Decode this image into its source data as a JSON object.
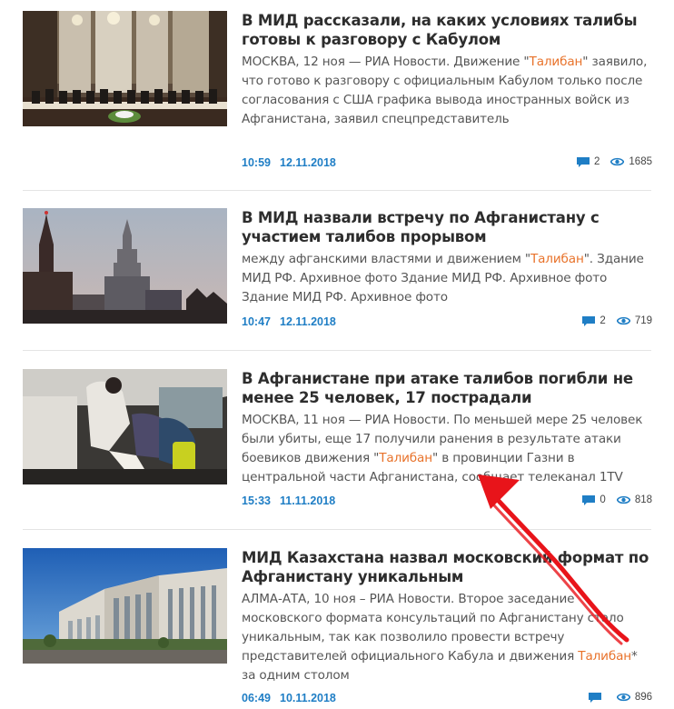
{
  "highlight_color": "#e8722a",
  "link_color": "#1f7ec5",
  "annotation_color": "#e8141a",
  "items": [
    {
      "title": "В МИД рассказали, на каких условиях талибы готовы к разговору с Кабулом",
      "lead_before": "МОСКВА, 12 ноя — РИА Новости. Движение \"",
      "lead_highlight": "Талибан",
      "lead_after": "\" заявило, что готово к разговору с официальным Кабулом только после согласования с США графика вывода иностранных войск из Афганистана, заявил спецпредставитель",
      "time": "10:59",
      "date": "12.11.2018",
      "comments": "2",
      "views": "1685",
      "thumb_icon": "conference-photo"
    },
    {
      "title": "В МИД назвали встречу по Афганистану с участием талибов прорывом",
      "lead_before": "между афганскими властями и движением \"",
      "lead_highlight": "Талибан",
      "lead_after": "\". Здание МИД РФ. Архивное фото Здание МИД РФ. Архивное фото Здание МИД РФ. Архивное фото",
      "time": "10:47",
      "date": "12.11.2018",
      "comments": "2",
      "views": "719",
      "thumb_icon": "moscow-skyline-photo"
    },
    {
      "title": "В Афганистане при атаке талибов погибли не менее 25 человек, 17 пострадали",
      "lead_before": "МОСКВА, 11 ноя — РИА Новости. По меньшей мере 25 человек были убиты, еще 17 получили ранения в результате атаки боевиков движения \"",
      "lead_highlight": "Талибан",
      "lead_after": "\" в провинции Газни в центральной части Афганистана, сообщает телеканал 1TV",
      "time": "15:33",
      "date": "11.11.2018",
      "comments": "0",
      "views": "818",
      "thumb_icon": "ambulance-photo"
    },
    {
      "title": "МИД Казахстана назвал московский формат по Афганистану уникальным",
      "lead_before": "АЛМА-АТА, 10 ноя – РИА Новости. Второе заседание московского формата консультаций по Афганистану стало уникальным, так как позволило провести встречу представителей официального Кабула и движения ",
      "lead_highlight": "Талибан",
      "lead_after": "* за одним столом",
      "time": "06:49",
      "date": "10.11.2018",
      "comments": "",
      "views": "896",
      "thumb_icon": "ministry-building-photo"
    }
  ]
}
